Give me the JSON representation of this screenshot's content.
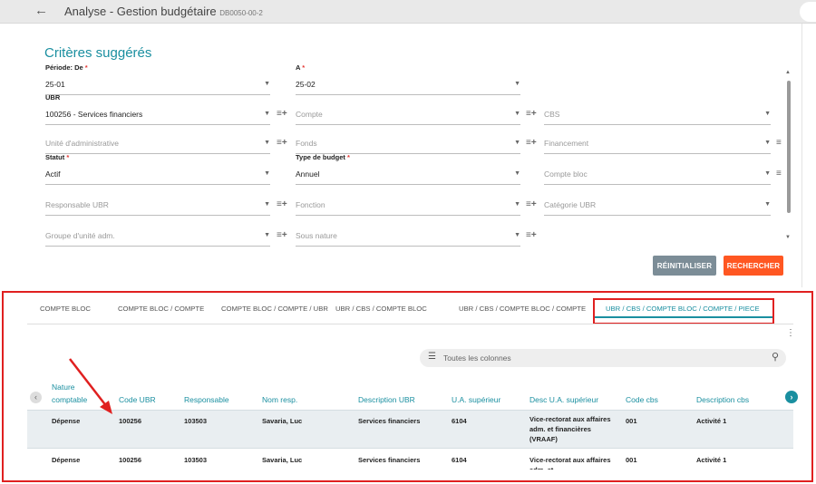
{
  "app": {
    "back_glyph": "←",
    "title": "Analyse - Gestion budgétaire",
    "code": "DB0050-00-2"
  },
  "criteria": {
    "title": "Critères suggérés",
    "fields": {
      "periode_de": {
        "label": "Période: De",
        "value": "25-01"
      },
      "a": {
        "label": "A",
        "value": "25-02"
      },
      "ubr": {
        "label": "UBR",
        "value": "100256 - Services financiers"
      },
      "compte": {
        "placeholder": "Compte"
      },
      "cbs": {
        "placeholder": "CBS"
      },
      "unite_admin": {
        "placeholder": "Unité d'administrative"
      },
      "fonds": {
        "placeholder": "Fonds"
      },
      "financement": {
        "placeholder": "Financement"
      },
      "statut": {
        "label": "Statut",
        "value": "Actif"
      },
      "type_budget": {
        "label": "Type de budget",
        "value": "Annuel"
      },
      "compte_bloc": {
        "placeholder": "Compte bloc"
      },
      "responsable_ubr": {
        "placeholder": "Responsable UBR"
      },
      "fonction": {
        "placeholder": "Fonction"
      },
      "categorie_ubr": {
        "placeholder": "Catégorie UBR"
      },
      "groupe_unite": {
        "placeholder": "Groupe d'unité adm."
      },
      "sous_nature": {
        "placeholder": "Sous nature"
      }
    },
    "required_mark": "*",
    "reset_label": "RÉINITIALISER",
    "search_label": "RECHERCHER"
  },
  "tabs": [
    {
      "label": "COMPTE BLOC"
    },
    {
      "label": "COMPTE BLOC / COMPTE"
    },
    {
      "label": "COMPTE BLOC / COMPTE / UBR"
    },
    {
      "label": "UBR / CBS / COMPTE BLOC"
    },
    {
      "label": "UBR / CBS / COMPTE BLOC / COMPTE"
    },
    {
      "label": "UBR / CBS / COMPTE BLOC / COMPTE / PIECE"
    }
  ],
  "grid": {
    "search_placeholder": "Toutes les colonnes",
    "columns": {
      "nature_1": "Nature",
      "nature_2": "comptable",
      "code_ubr": "Code UBR",
      "responsable": "Responsable",
      "nom_resp": "Nom resp.",
      "desc_ubr": "Description UBR",
      "ua_sup": "U.A. supérieur",
      "desc_ua_sup": "Desc U.A. supérieur",
      "code_cbs": "Code cbs",
      "desc_cbs": "Description cbs"
    },
    "rows": [
      {
        "nature": "Dépense",
        "code_ubr": "100256",
        "responsable": "103503",
        "nom_resp": "Savaria, Luc",
        "desc_ubr": "Services financiers",
        "ua_sup": "6104",
        "desc_ua_sup": "Vice-rectorat aux affaires adm. et financières (VRAAF)",
        "code_cbs": "001",
        "desc_cbs": "Activité 1"
      },
      {
        "nature": "Dépense",
        "code_ubr": "100256",
        "responsable": "103503",
        "nom_resp": "Savaria, Luc",
        "desc_ubr": "Services financiers",
        "ua_sup": "6104",
        "desc_ua_sup": "Vice-rectorat aux affaires adm. et",
        "code_cbs": "001",
        "desc_cbs": "Activité 1"
      }
    ]
  }
}
